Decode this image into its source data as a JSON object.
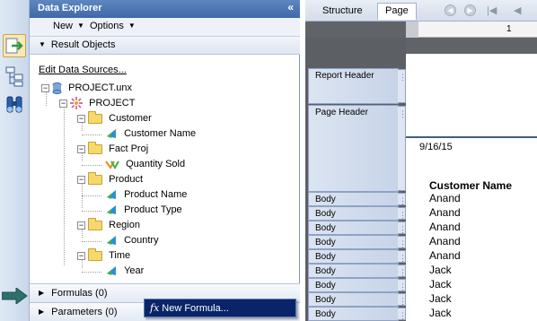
{
  "left_panel": {
    "title": "Data Explorer",
    "collapse_glyph": "«",
    "toolbar": {
      "new_label": "New",
      "options_label": "Options"
    },
    "result_objects_label": "Result Objects",
    "edit_data_sources_label": "Edit Data Sources...",
    "tree": {
      "root": "PROJECT.unx",
      "universe": "PROJECT",
      "folders": [
        {
          "name": "Customer",
          "items": [
            "Customer Name"
          ]
        },
        {
          "name": "Fact Proj",
          "items": [
            "Quantity Sold"
          ]
        },
        {
          "name": "Product",
          "items": [
            "Product Name",
            "Product Type"
          ]
        },
        {
          "name": "Region",
          "items": [
            "Country"
          ]
        },
        {
          "name": "Time",
          "items": [
            "Year"
          ]
        }
      ]
    },
    "formulas_label": "Formulas (0)",
    "parameters_label": "Parameters (0)"
  },
  "context_menu": {
    "fx_glyph": "fx",
    "new_formula_label": "New Formula..."
  },
  "right_pane": {
    "tabs": [
      "Structure",
      "Page"
    ],
    "active_tab": "Page",
    "ruler_mark": "1",
    "sections": {
      "report_header": "Report Header",
      "page_header": "Page Header",
      "body_rows": [
        "Body",
        "Body",
        "Body",
        "Body",
        "Body",
        "Body",
        "Body",
        "Body",
        "Body"
      ]
    },
    "date_text": "9/16/15",
    "column_header": "Customer Name",
    "column_values": [
      "Anand",
      "Anand",
      "Anand",
      "Anand",
      "Anand",
      "Jack",
      "Jack",
      "Jack",
      "Jack"
    ]
  },
  "icons": [
    "export-icon",
    "hierarchy-icon",
    "binoculars-icon",
    "first-page-icon",
    "previous-icon",
    "next-icon"
  ],
  "colors": {
    "title_bar": "#3f69a8",
    "menu_highlight": "#0a246a",
    "workspace": "#606468"
  }
}
